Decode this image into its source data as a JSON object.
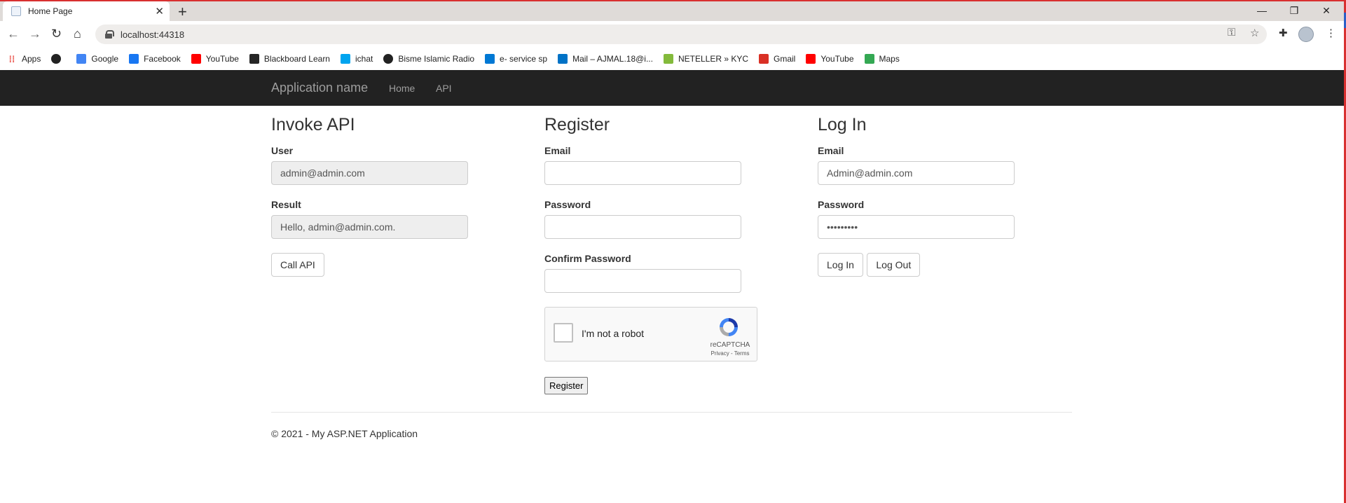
{
  "browser": {
    "tab_title": "Home Page",
    "url": "localhost:44318",
    "bookmarks": [
      {
        "label": "Apps",
        "icon": "apps-grid-icon",
        "color": "#e8453c"
      },
      {
        "label": "",
        "icon": "globe-icon",
        "color": "#222222"
      },
      {
        "label": "Google",
        "icon": "google-icon",
        "color": "#4285f4"
      },
      {
        "label": "Facebook",
        "icon": "facebook-icon",
        "color": "#1877f2"
      },
      {
        "label": "YouTube",
        "icon": "youtube-icon",
        "color": "#ff0000"
      },
      {
        "label": "Blackboard Learn",
        "icon": "blackboard-icon",
        "color": "#262626"
      },
      {
        "label": "ichat",
        "icon": "windows-icon",
        "color": "#00a4ef"
      },
      {
        "label": "Bisme Islamic Radio",
        "icon": "globe-icon",
        "color": "#222222"
      },
      {
        "label": "e- service sp",
        "icon": "sharepoint-icon",
        "color": "#0078d4"
      },
      {
        "label": "Mail – AJMAL.18@i...",
        "icon": "outlook-icon",
        "color": "#0072c6"
      },
      {
        "label": "NETELLER » KYC",
        "icon": "neteller-icon",
        "color": "#83ba3b"
      },
      {
        "label": "Gmail",
        "icon": "gmail-icon",
        "color": "#d93025"
      },
      {
        "label": "YouTube",
        "icon": "youtube-icon",
        "color": "#ff0000"
      },
      {
        "label": "Maps",
        "icon": "maps-pin-icon",
        "color": "#34a853"
      }
    ]
  },
  "navbar": {
    "brand": "Application name",
    "links": [
      "Home",
      "API"
    ]
  },
  "invoke": {
    "heading": "Invoke API",
    "user_label": "User",
    "user_value": "admin@admin.com",
    "result_label": "Result",
    "result_value": "Hello, admin@admin.com.",
    "call_button": "Call API"
  },
  "register": {
    "heading": "Register",
    "email_label": "Email",
    "email_value": "",
    "password_label": "Password",
    "password_value": "",
    "confirm_label": "Confirm Password",
    "confirm_value": "",
    "captcha_text": "I'm not a robot",
    "captcha_brand": "reCAPTCHA",
    "captcha_links": "Privacy - Terms",
    "register_button": "Register"
  },
  "login": {
    "heading": "Log In",
    "email_label": "Email",
    "email_value": "Admin@admin.com",
    "password_label": "Password",
    "password_value": "•••••••••",
    "login_button": "Log In",
    "logout_button": "Log Out"
  },
  "footer": {
    "text": "© 2021 - My ASP.NET Application"
  },
  "colors": {
    "navbar_bg": "#222222",
    "navbar_text": "#9d9d9d",
    "frame_border": "#d83030"
  }
}
